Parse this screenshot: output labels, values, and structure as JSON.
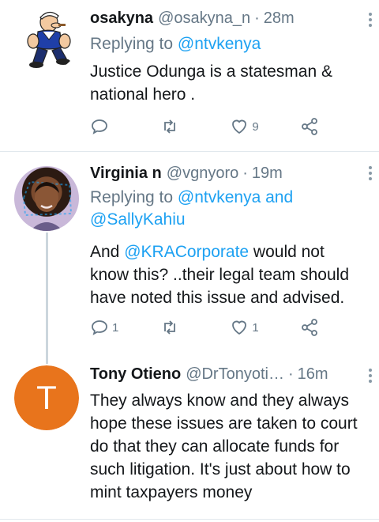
{
  "tweets": [
    {
      "name": "osakyna",
      "handle": "@osakyna_n",
      "dot": "·",
      "time": "28m",
      "reply_prefix": "Replying to ",
      "reply_mention": "@ntvkenya",
      "text": "Justice Odunga is a statesman & national hero .",
      "avatar_icon": "popeye-cartoon-avatar",
      "reply_count": "",
      "retweet_count": "",
      "like_count": "9"
    },
    {
      "name": "Virginia n",
      "handle": "@vgnyoro",
      "dot": "·",
      "time": "19m",
      "reply_prefix": "Replying to ",
      "reply_mention_1": "@ntvkenya",
      "reply_and": " and",
      "reply_mention_2": "@SallyKahiu",
      "text_before": "And ",
      "text_mention": "@KRACorporate",
      "text_after": " would not know this? ..their legal team should have noted this issue and advised.",
      "avatar_icon": "photo-avatar",
      "reply_count": "1",
      "retweet_count": "",
      "like_count": "1"
    },
    {
      "name": "Tony Otieno",
      "handle": "@DrTonyoti…",
      "dot": "·",
      "time": "16m",
      "text": "They always know and they always hope these issues are taken to court do that they can allocate funds for such litigation. It's just about how to mint taxpayers money",
      "avatar_letter": "T",
      "avatar_color": "#e8741c"
    }
  ],
  "colors": {
    "link": "#1da1f2",
    "secondary": "#657786",
    "divider": "#e1e8ed",
    "thread_line": "#ccd6dd"
  },
  "icons": {
    "reply": "reply-icon",
    "retweet": "retweet-icon",
    "like": "heart-icon",
    "share": "share-icon",
    "more": "more-vertical-icon"
  }
}
